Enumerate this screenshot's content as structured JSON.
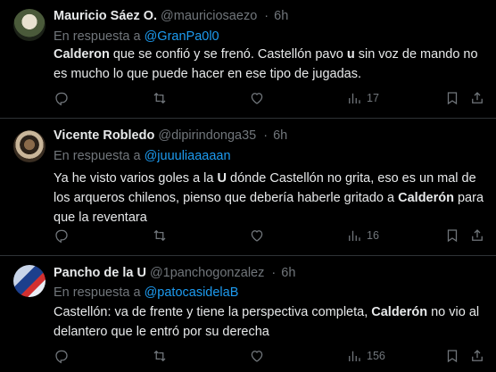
{
  "tweets": [
    {
      "name": "Mauricio Sáez O.",
      "handle": "@mauriciosaezo",
      "sep": "·",
      "time": "6h",
      "reply_prefix": "En respuesta a",
      "reply_to": "@GranPa0l0",
      "text_bold_1": "Calderon",
      "text_1": " que se confió y se frenó. Castellón pavo ",
      "text_bold_2": "u",
      "text_2": " sin voz de mando no es mucho lo que puede hacer en ese tipo de jugadas.",
      "views": "17"
    },
    {
      "name": "Vicente Robledo",
      "handle": "@dipirindonga35",
      "sep": "·",
      "time": "6h",
      "reply_prefix": "En respuesta a",
      "reply_to": "@juuuliaaaaan",
      "text_1": "Ya he visto varios goles a la ",
      "text_bold_1": "U",
      "text_2": " dónde Castellón no grita, eso es un mal de los arqueros chilenos, pienso que debería haberle gritado a ",
      "text_bold_2": "Calderón",
      "text_3": " para que la reventara",
      "views": "16"
    },
    {
      "name": "Pancho de la U",
      "handle": "@1panchogonzalez",
      "sep": "·",
      "time": "6h",
      "reply_prefix": "En respuesta a",
      "reply_to": "@patocasidelaB",
      "text_1": "Castellón: va de frente y tiene la perspectiva completa, ",
      "text_bold_1": "Calderón",
      "text_2": " no vio al delantero que le entró por su derecha",
      "views": "156"
    }
  ],
  "colors": {
    "background": "#000000",
    "text": "#e7e9ea",
    "muted": "#71767b",
    "link": "#1d9bf0",
    "divider": "#2f3336"
  },
  "icons": [
    "reply-icon",
    "retweet-icon",
    "like-icon",
    "views-icon",
    "bookmark-icon",
    "share-icon"
  ]
}
